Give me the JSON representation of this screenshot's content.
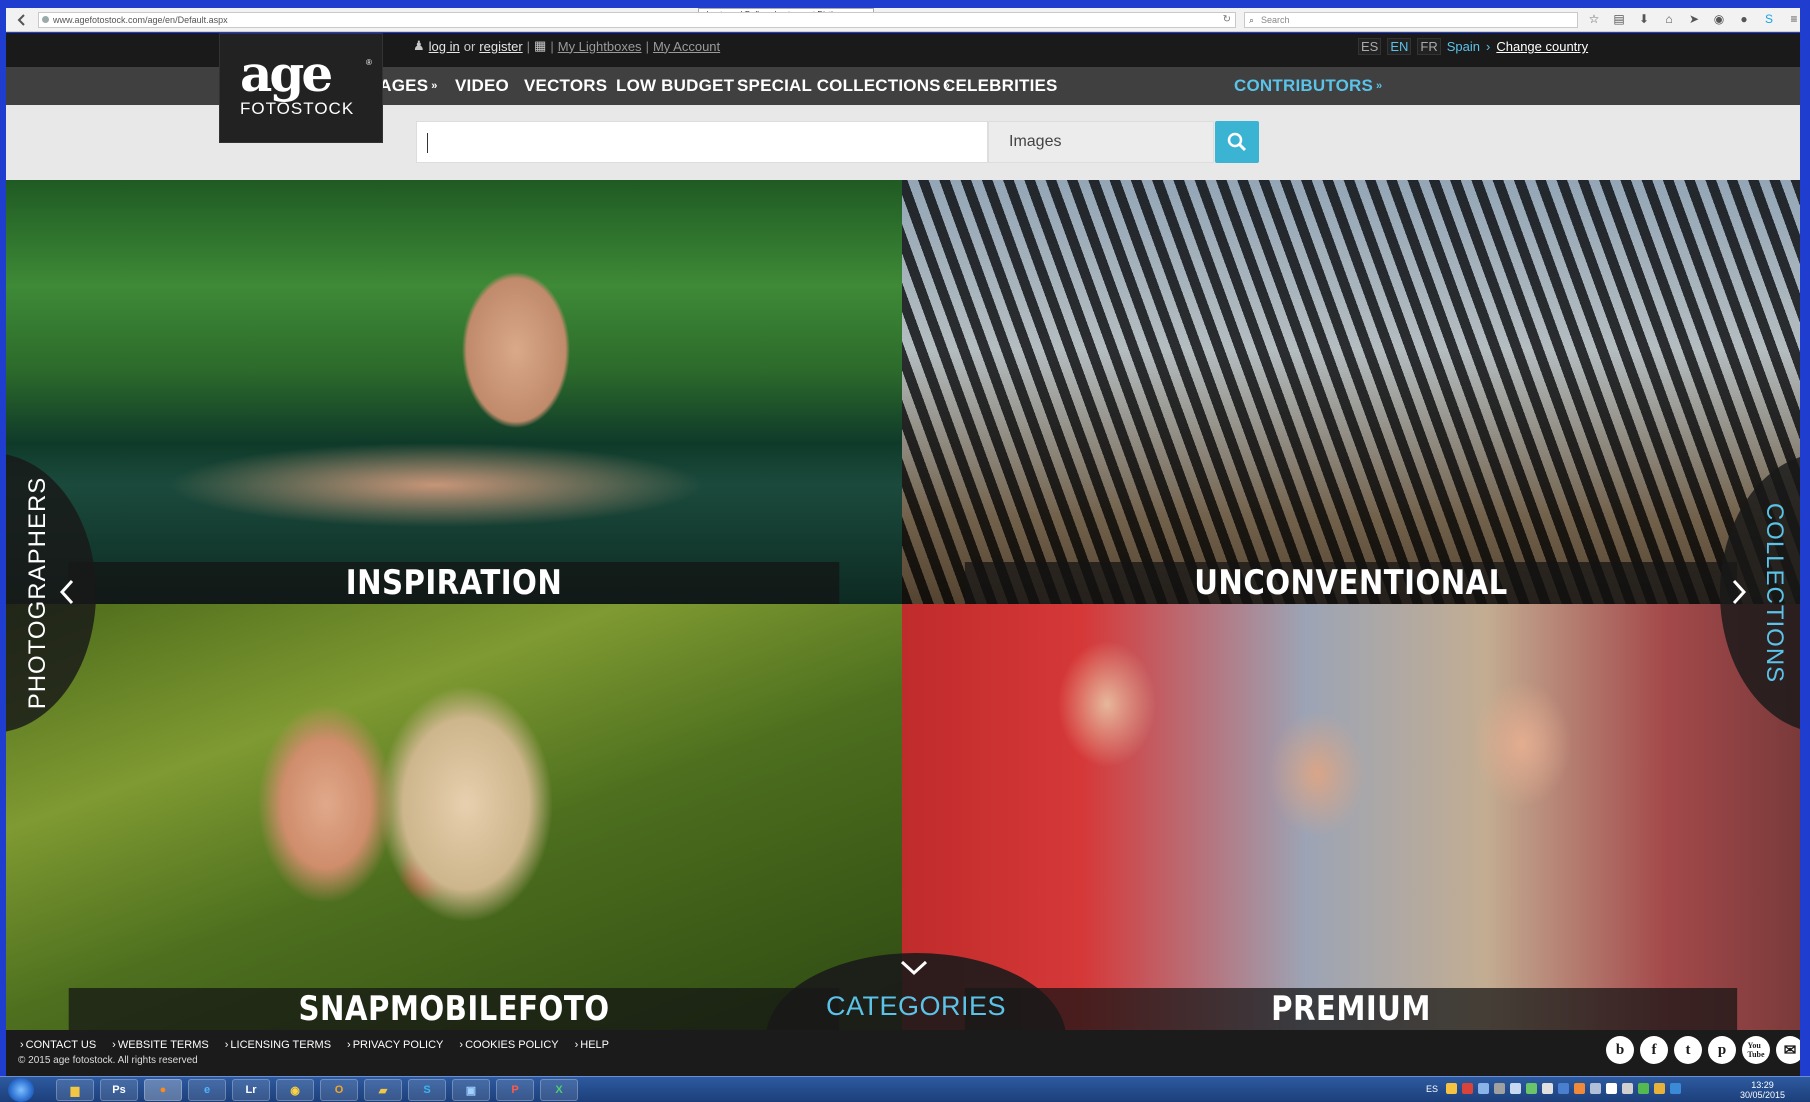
{
  "browser": {
    "tab_title": "abentener | Define abentener at Dictionary.com",
    "url": "www.agefotostock.com/age/en/Default.aspx",
    "search_placeholder": "Search"
  },
  "header": {
    "login": "log in",
    "or": "or",
    "register": "register",
    "lightboxes": "My Lightboxes",
    "account": "My Account",
    "languages": [
      "ES",
      "EN",
      "FR"
    ],
    "active_language": "EN",
    "country": "Spain",
    "change_country": "Change country"
  },
  "logo": {
    "age": "age",
    "fotostock": "FOTOSTOCK"
  },
  "nav": {
    "images": "IMAGES",
    "video": "VIDEO",
    "vectors": "VECTORS",
    "low_budget": "LOW BUDGET",
    "special_collections": "SPECIAL COLLECTIONS",
    "celebrities": "CELEBRITIES",
    "contributors": "CONTRIBUTORS"
  },
  "search": {
    "value": "",
    "type": "Images"
  },
  "tiles": {
    "inspiration": "INSPIRATION",
    "unconventional": "UNCONVENTIONAL",
    "snap": "SNAPMOBILEFOTO",
    "premium": "PREMIUM"
  },
  "side": {
    "left": "PHOTOGRAPHERS",
    "right": "COLLECTIONS",
    "bottom": "CATEGORIES"
  },
  "footer": {
    "links": [
      "CONTACT US",
      "WEBSITE TERMS",
      "LICENSING TERMS",
      "PRIVACY POLICY",
      "COOKIES POLICY",
      "HELP"
    ],
    "copyright": "© 2015 age fotostock. All rights reserved"
  },
  "social": [
    "blog",
    "f",
    "t",
    "p",
    "You Tube",
    "mail"
  ],
  "taskbar": {
    "lang": "ES",
    "time": "13:29",
    "date": "30/05/2015"
  },
  "colors": {
    "accent": "#5bc2e8",
    "search_button": "#3bb4d4",
    "nav_bg": "#404040",
    "header_bg": "#1a1a1a"
  }
}
